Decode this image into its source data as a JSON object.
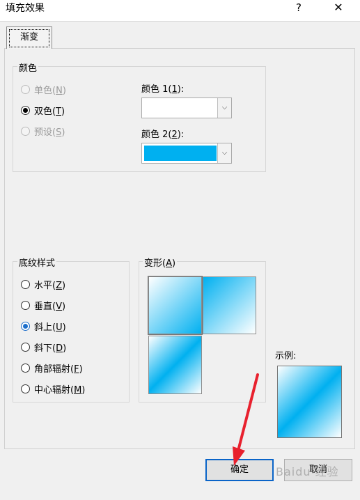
{
  "dialog": {
    "title": "填充效果",
    "help": "?",
    "close": "✕"
  },
  "tabs": [
    {
      "label": "渐变"
    }
  ],
  "colors_group": {
    "label": "颜色",
    "options": [
      {
        "text": "单色(",
        "key": "N",
        "end": ")",
        "checked": false,
        "disabled": true
      },
      {
        "text": "双色(",
        "key": "T",
        "end": ")",
        "checked": true,
        "disabled": false
      },
      {
        "text": "预设(",
        "key": "S",
        "end": ")",
        "checked": false,
        "disabled": true
      }
    ],
    "color1": {
      "label_prefix": "颜色 1(",
      "key": "1",
      "label_suffix": "):",
      "value": "#ffffff"
    },
    "color2": {
      "label_prefix": "颜色 2(",
      "key": "2",
      "label_suffix": "):",
      "value": "#00b0f0"
    }
  },
  "shading_group": {
    "label": "底纹样式",
    "options": [
      {
        "text": "水平(",
        "key": "Z",
        "end": ")",
        "checked": false
      },
      {
        "text": "垂直(",
        "key": "V",
        "end": ")",
        "checked": false
      },
      {
        "text": "斜上(",
        "key": "U",
        "end": ")",
        "checked": true
      },
      {
        "text": "斜下(",
        "key": "D",
        "end": ")",
        "checked": false
      },
      {
        "text": "角部辐射(",
        "key": "F",
        "end": ")",
        "checked": false
      },
      {
        "text": "中心辐射(",
        "key": "M",
        "end": ")",
        "checked": false
      }
    ]
  },
  "variants": {
    "label_prefix": "变形(",
    "key": "A",
    "label_suffix": ")"
  },
  "sample": {
    "label": "示例:"
  },
  "buttons": {
    "ok": "确定",
    "cancel": "取消"
  },
  "watermark": "Baidu 经验",
  "accent": "#00b0f0"
}
